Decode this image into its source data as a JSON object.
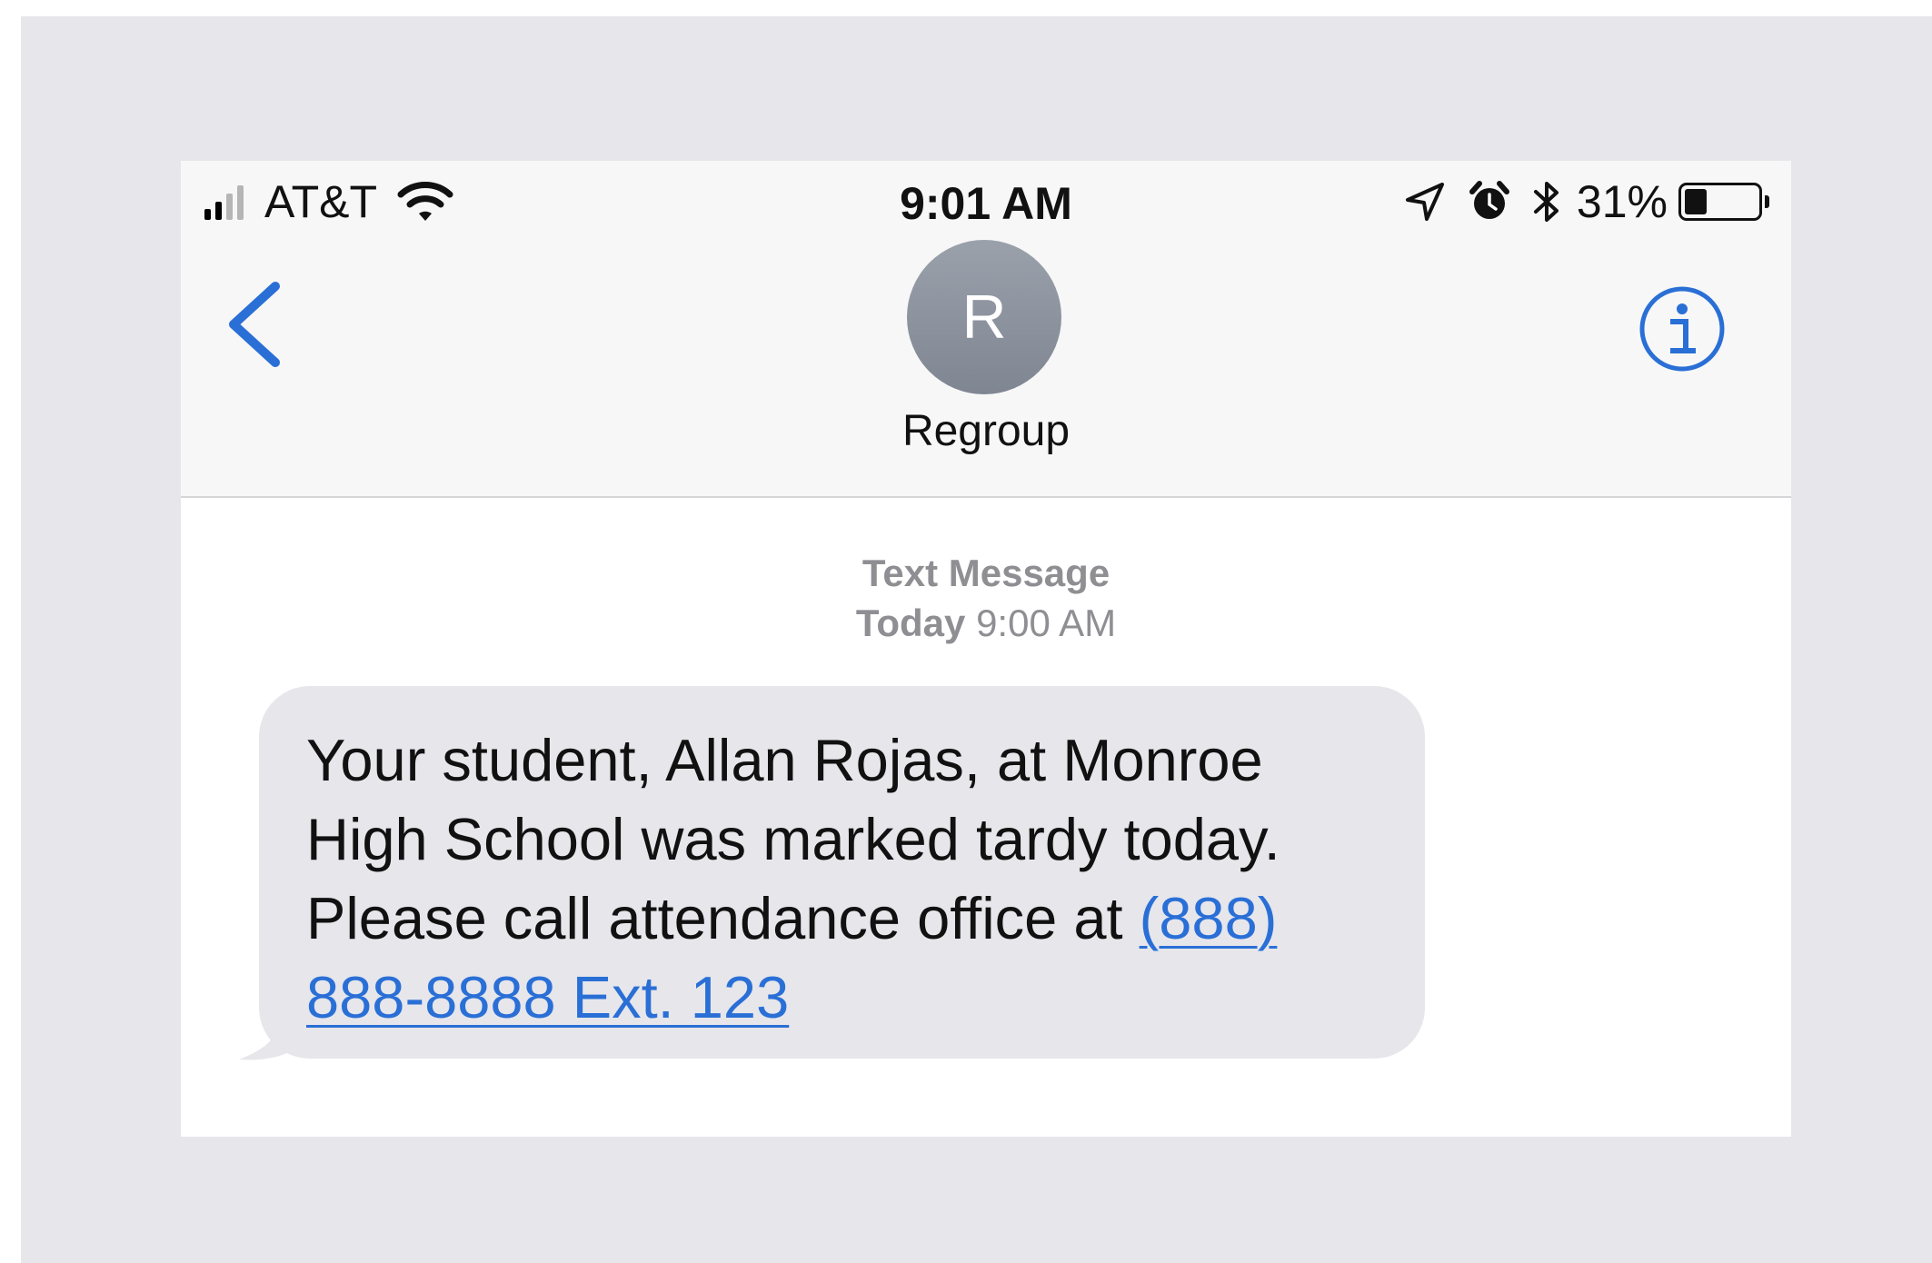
{
  "status_bar": {
    "carrier": "AT&T",
    "time": "9:01 AM",
    "battery_percent": "31%",
    "battery_level": 0.31,
    "signal_bars_filled": 2,
    "signal_bars_total": 4,
    "icons": [
      "signal-icon",
      "wifi-icon",
      "location-arrow-icon",
      "alarm-icon",
      "bluetooth-icon",
      "battery-icon"
    ]
  },
  "header": {
    "avatar_initial": "R",
    "contact_name": "Regroup",
    "back_icon": "chevron-left-icon",
    "info_icon": "info-icon"
  },
  "thread": {
    "label_type": "Text Message",
    "label_day": "Today",
    "label_time": "9:00 AM"
  },
  "message": {
    "text": "Your student, Allan Rojas, at Monroe High School was marked tardy today. Please call attendance office at",
    "link": "(888) 888-8888 Ext. 123"
  },
  "colors": {
    "accent": "#2a6fd6",
    "bubble_incoming": "#e6e6eb",
    "backdrop": "#e6e6eb",
    "header_bg": "#f7f7f7",
    "avatar": "#8a909b",
    "secondary_text": "#8e8e93"
  }
}
